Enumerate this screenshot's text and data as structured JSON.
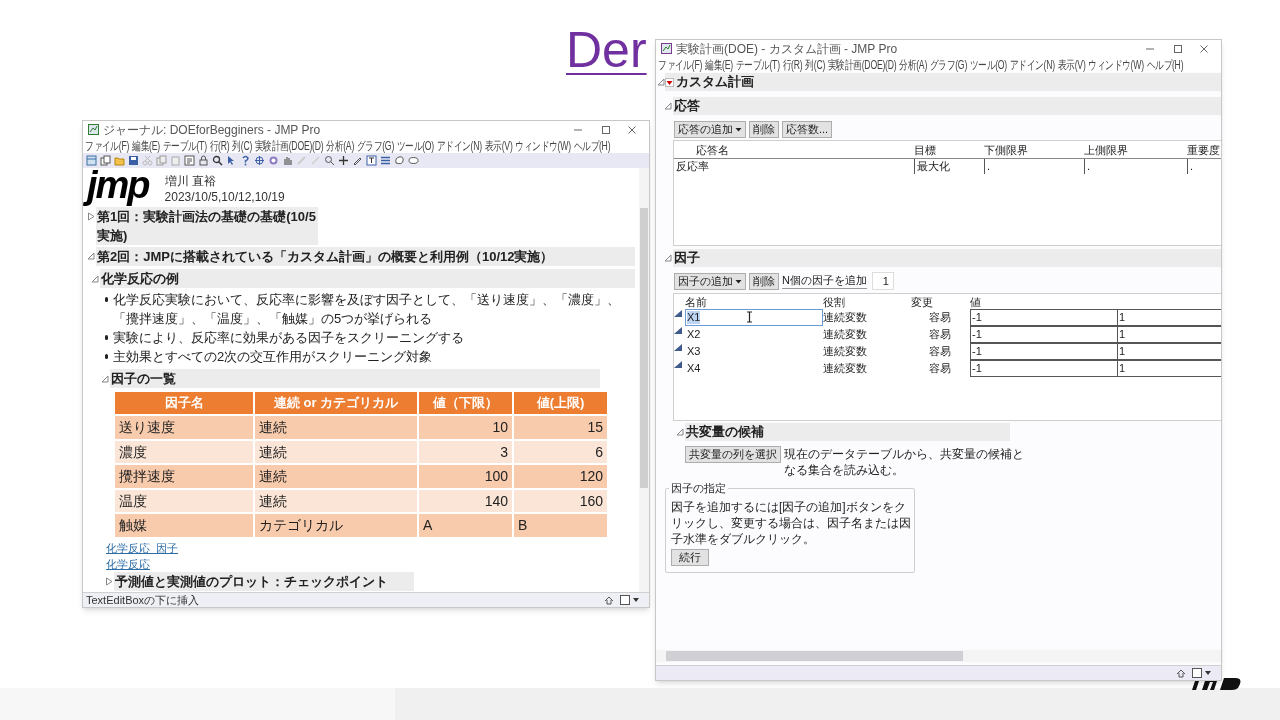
{
  "slide": {
    "title": "Der"
  },
  "journal_window": {
    "title": "ジャーナル: DOEforBegginers - JMP Pro",
    "menu": [
      "ファイル(F)",
      "編集(E)",
      "テーブル(T)",
      "行(R)",
      "列(C)",
      "実験計画(DOE)(D)",
      "分析(A)",
      "グラフ(G)",
      "ツール(O)",
      "アドイン(N)",
      "表示(V)",
      "ウィンドウ(W)",
      "ヘルプ(H)"
    ],
    "logo": "jmp",
    "author": "増川 直裕",
    "dates": "2023/10/5,10/12,10/19",
    "outline": [
      {
        "title": "第1回：実験計画法の基礎の基礎(10/5実施)",
        "expanded": false
      },
      {
        "title": "第2回：JMPに搭載されている「カスタム計画」の概要と利用例（10/12実施）",
        "expanded": true
      }
    ],
    "section": {
      "title": "化学反応の例",
      "expanded": true
    },
    "bullets": [
      "化学反応実験において、反応率に影響を及ぼす因子として、「送り速度」、「濃度」、「攪拌速度」、「温度」、「触媒」の5つが挙げられる",
      "実験により、反応率に効果がある因子をスクリーニングする",
      "主効果とすべての2次の交互作用がスクリーニング対象"
    ],
    "subsection": {
      "title": "因子の一覧",
      "expanded": true
    },
    "table": {
      "columns": [
        "因子名",
        "連続 or カテゴリカル",
        "値（下限）",
        "値(上限)"
      ],
      "rows": [
        {
          "kind": "continuous",
          "cells": [
            "送り速度",
            "連続",
            "10",
            "15"
          ]
        },
        {
          "kind": "continuous",
          "cells": [
            "濃度",
            "連続",
            "3",
            "6"
          ]
        },
        {
          "kind": "continuous",
          "cells": [
            "攪拌速度",
            "連続",
            "100",
            "120"
          ]
        },
        {
          "kind": "continuous",
          "cells": [
            "温度",
            "連続",
            "140",
            "160"
          ]
        },
        {
          "kind": "categorical",
          "cells": [
            "触媒",
            "カテゴリカル",
            "A",
            "B"
          ]
        }
      ]
    },
    "links": [
      "化学反応_因子",
      "化学反応"
    ],
    "next_section": {
      "title": "予測値と実測値のプロット：チェックポイント",
      "expanded": false
    },
    "status_bar": "TextEditBoxの下に挿入"
  },
  "doe_window": {
    "title": "実験計画(DOE) - カスタム計画 - JMP Pro",
    "menu": [
      "ファイル(F)",
      "編集(E)",
      "テーブル(T)",
      "行(R)",
      "列(C)",
      "実験計画(DOE)(D)",
      "分析(A)",
      "グラフ(G)",
      "ツール(O)",
      "アドイン(N)",
      "表示(V)",
      "ウィンドウ(W)",
      "ヘルプ(H)"
    ],
    "heading": {
      "title": "カスタム計画",
      "expanded": true
    },
    "responses": {
      "title": "応答",
      "expanded": true,
      "add_button": "応答の追加",
      "delete_button": "削除",
      "count_button": "応答数...",
      "columns": [
        "応答名",
        "目標",
        "下側限界",
        "上側限界",
        "重要度"
      ],
      "rows": [
        [
          "反応率",
          "最大化",
          ".",
          ".",
          "."
        ]
      ]
    },
    "factors": {
      "title": "因子",
      "expanded": true,
      "add_button": "因子の追加",
      "delete_button": "削除",
      "n_label": "N個の因子を追加",
      "n_value": "1",
      "columns": [
        "名前",
        "役割",
        "変更",
        "値"
      ],
      "rows": [
        {
          "name": "X1",
          "role": "連続変数",
          "change": "容易",
          "low": "-1",
          "high": "1",
          "selected": true
        },
        {
          "name": "X2",
          "role": "連続変数",
          "change": "容易",
          "low": "-1",
          "high": "1",
          "selected": false
        },
        {
          "name": "X3",
          "role": "連続変数",
          "change": "容易",
          "low": "-1",
          "high": "1",
          "selected": false
        },
        {
          "name": "X4",
          "role": "連続変数",
          "change": "容易",
          "low": "-1",
          "high": "1",
          "selected": false
        }
      ]
    },
    "covariates": {
      "title": "共変量の候補",
      "expanded": true,
      "button": "共変量の列を選択",
      "text": "現在のデータテーブルから、共変量の候補となる集合を読み込む。"
    },
    "factor_spec": {
      "title": "因子の指定",
      "text": "因子を追加するには[因子の追加]ボタンをクリックし、変更する場合は、因子名または因子水準をダブルクリック。",
      "button": "続行"
    }
  }
}
